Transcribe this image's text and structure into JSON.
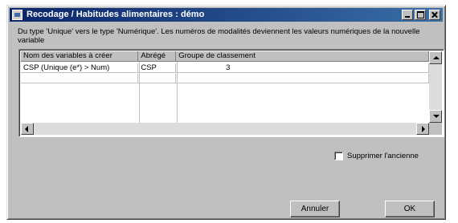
{
  "window": {
    "title": "Recodage / Habitudes alimentaires : démo"
  },
  "info_text": "Du type 'Unique' vers le type 'Numérique'. Les numéros de modalités deviennent les valeurs numériques de la nouvelle variable",
  "grid": {
    "columns": [
      "Nom des variables à créer",
      "Abrégé",
      "Groupe de classement"
    ],
    "rows": [
      [
        "CSP (Unique (e*) > Num)",
        "CSP",
        "3"
      ]
    ]
  },
  "options": {
    "suppress_label": "Supprimer l'ancienne",
    "suppress_checked": false
  },
  "buttons": {
    "cancel": "Annuler",
    "ok": "OK"
  }
}
